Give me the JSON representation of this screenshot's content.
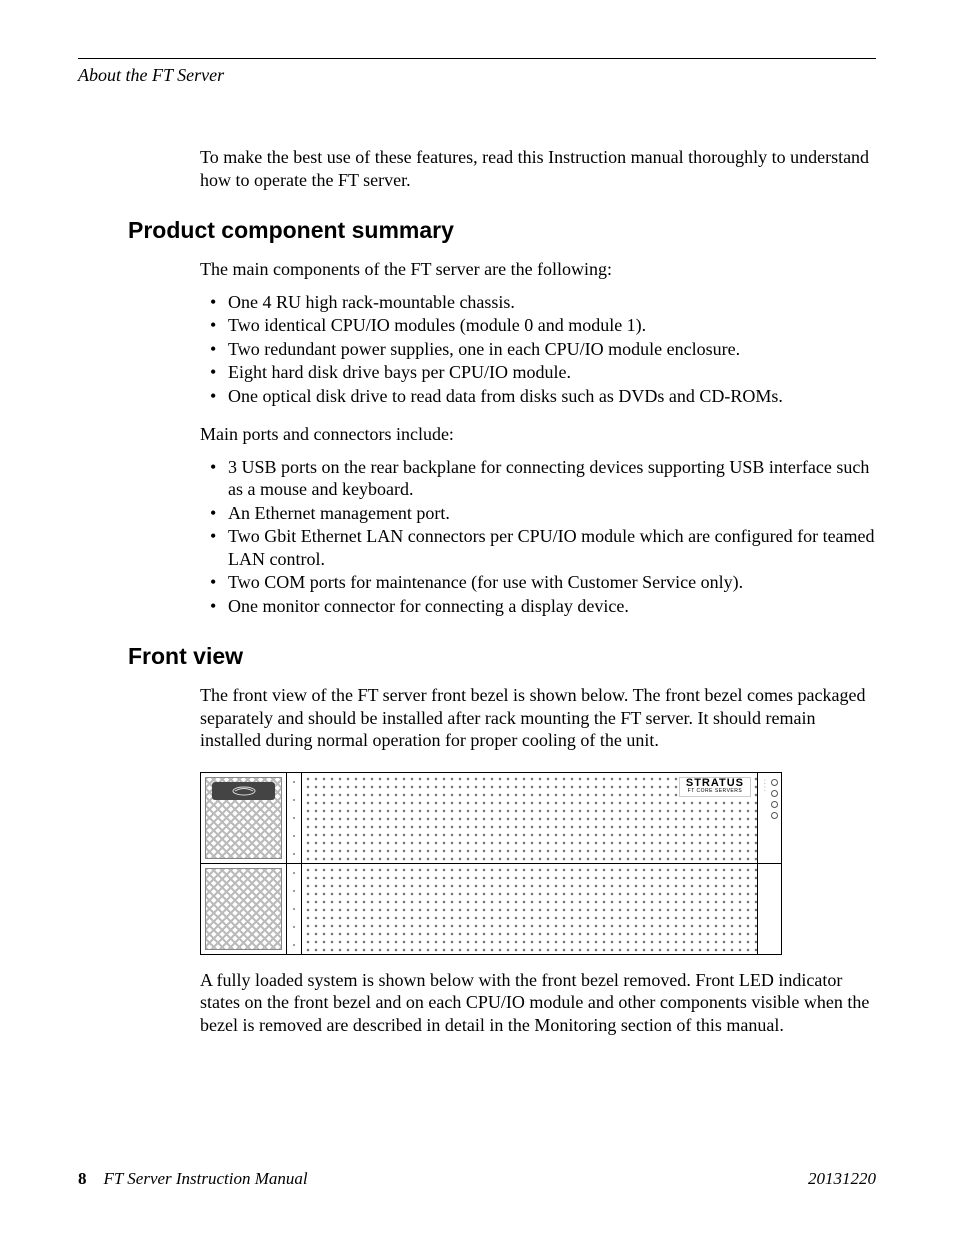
{
  "running_head": "About the FT Server",
  "intro_para": "To make the best use of these features, read this Instruction manual thoroughly to understand how to operate the FT server.",
  "section1": {
    "title": "Product component summary",
    "lead": "The main components of the FT server are the following:",
    "list1": [
      "One 4 RU high rack-mountable chassis.",
      "Two identical CPU/IO modules (module 0 and module 1).",
      "Two redundant power supplies, one in each CPU/IO module enclosure.",
      "Eight hard disk drive bays per CPU/IO module.",
      "One optical disk drive to read data from disks such as DVDs and CD-ROMs."
    ],
    "mid": "Main ports and connectors include:",
    "list2": [
      "3 USB ports on the rear backplane for connecting devices supporting USB interface such as a mouse and keyboard.",
      "An Ethernet management port.",
      "Two Gbit Ethernet LAN connectors per CPU/IO module which are configured for teamed LAN control.",
      "Two COM ports for maintenance (for use with Customer Service only).",
      "One monitor connector for connecting a display device."
    ]
  },
  "section2": {
    "title": "Front view",
    "para1": "The front view of the FT server front bezel is shown below. The front bezel comes packaged separately and should be installed after rack mounting the FT server. It should remain installed during normal operation for proper cooling of the unit.",
    "para2": "A fully loaded system is shown below with the front bezel removed. Front LED indicator states on the front bezel and on each CPU/IO module and other components visible when the bezel is removed are described in detail in the Monitoring section of this manual."
  },
  "figure": {
    "brand": "STRATUS",
    "brand_sub": "FT CORE SERVERS"
  },
  "footer": {
    "page": "8",
    "title": "FT Server Instruction Manual",
    "date": "20131220"
  }
}
